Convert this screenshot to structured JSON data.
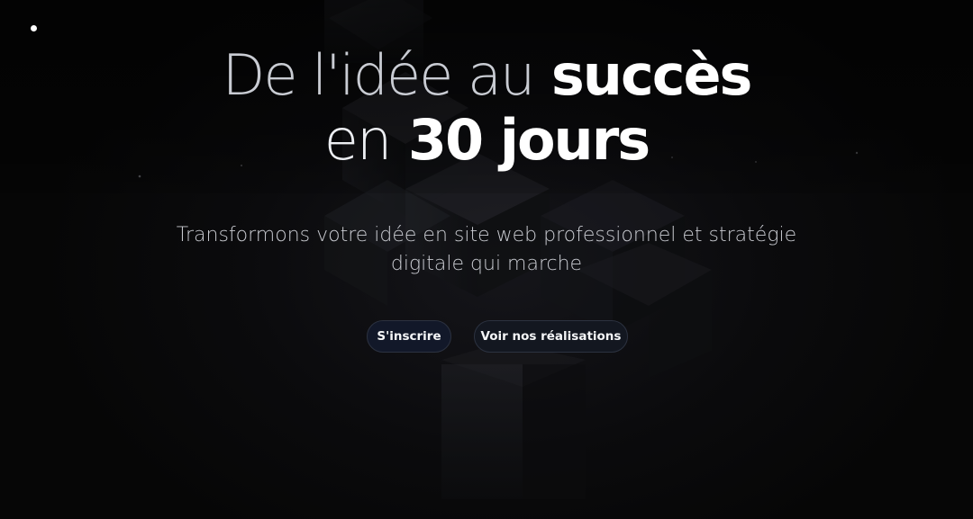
{
  "hero": {
    "headline": {
      "line1_light": "De l'idée au",
      "line1_bold": "succès",
      "line2_light": "en",
      "line2_bold": "30 jours"
    },
    "subtitle": "Transformons votre idée en site web professionnel et stratégie digitale qui marche"
  },
  "buttons": {
    "signup_label": "S'inscrire",
    "portfolio_label": "Voir nos réalisations"
  },
  "colors": {
    "background": "#060606",
    "button_bg": "#131720",
    "button_border": "#2c3240",
    "text_primary": "#ffffff",
    "text_muted": "#c8cad0"
  }
}
